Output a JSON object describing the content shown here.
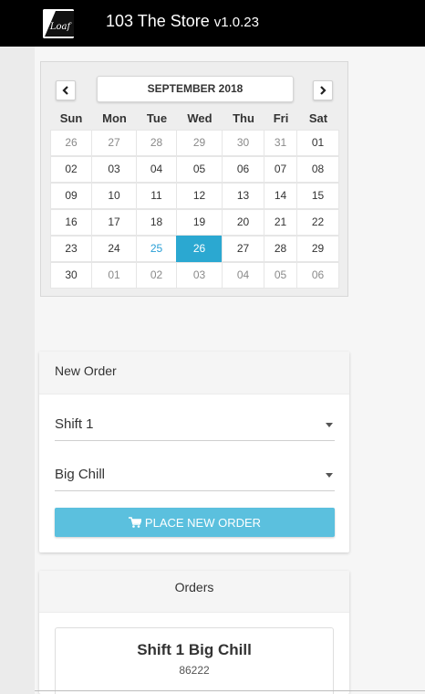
{
  "app": {
    "title": "103 The Store",
    "version": "v1.0.23",
    "logo_text": "Loaf"
  },
  "calendar": {
    "month_label": "SEPTEMBER 2018",
    "weekdays": [
      "Sun",
      "Mon",
      "Tue",
      "Wed",
      "Thu",
      "Fri",
      "Sat"
    ],
    "selected": "26",
    "today": "25",
    "accent_color": "#2ba8d1",
    "weeks": [
      [
        "26",
        "27",
        "28",
        "29",
        "30",
        "31",
        "01"
      ],
      [
        "02",
        "03",
        "04",
        "05",
        "06",
        "07",
        "08"
      ],
      [
        "09",
        "10",
        "11",
        "12",
        "13",
        "14",
        "15"
      ],
      [
        "16",
        "17",
        "18",
        "19",
        "20",
        "21",
        "22"
      ],
      [
        "23",
        "24",
        "25",
        "26",
        "27",
        "28",
        "29"
      ],
      [
        "30",
        "01",
        "02",
        "03",
        "04",
        "05",
        "06"
      ]
    ]
  },
  "new_order": {
    "title": "New Order",
    "shift_value": "Shift 1",
    "product_value": "Big Chill",
    "button_label": "PLACE NEW ORDER",
    "button_color": "#5bc0de",
    "button_icon": "cart-icon"
  },
  "orders": {
    "title": "Orders",
    "items": [
      {
        "name": "Shift 1 Big Chill",
        "id": "86222"
      }
    ]
  }
}
